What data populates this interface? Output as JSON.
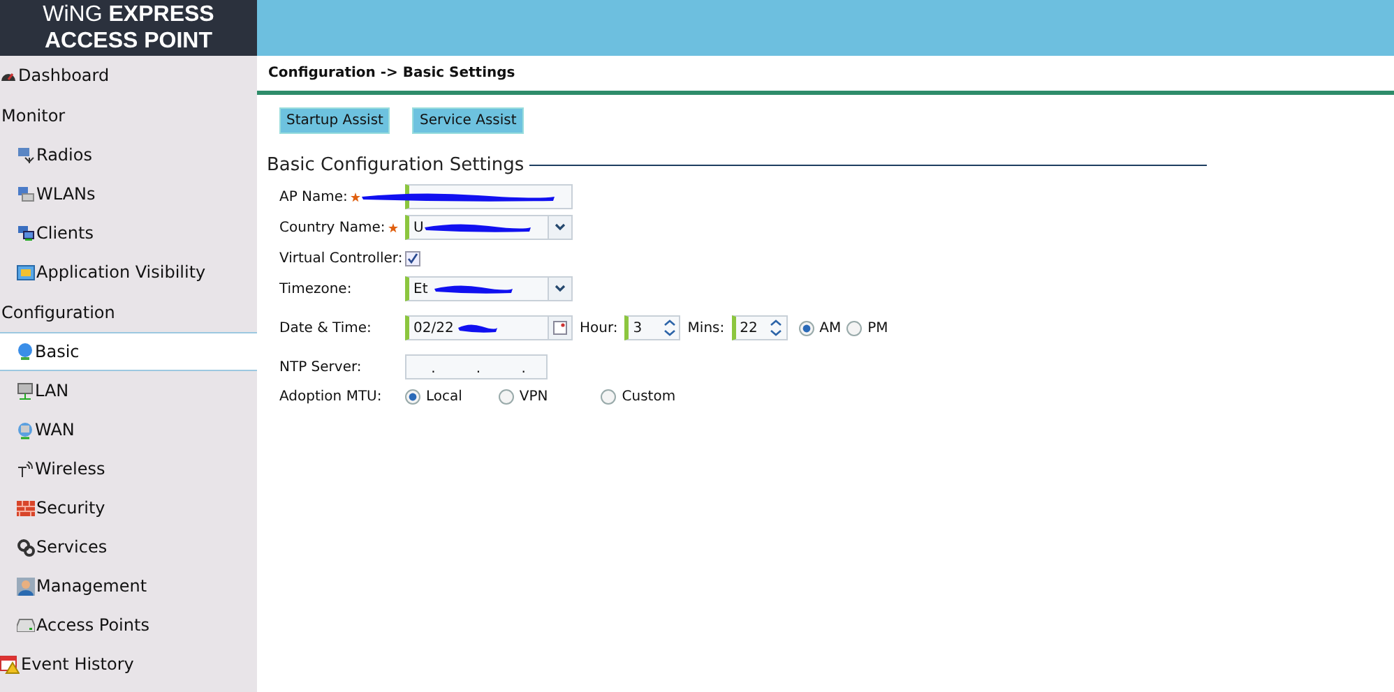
{
  "logo": {
    "line1_light": "WiNG",
    "line1_bold": "EXPRESS",
    "line2": "ACCESS POINT"
  },
  "sidebar": {
    "items": [
      {
        "kind": "link",
        "label": "Dashboard",
        "selected": false
      },
      {
        "kind": "heading",
        "label": "Monitor"
      },
      {
        "kind": "child",
        "label": "Radios",
        "selected": false
      },
      {
        "kind": "child",
        "label": "WLANs",
        "selected": false
      },
      {
        "kind": "child",
        "label": "Clients",
        "selected": false
      },
      {
        "kind": "child",
        "label": "Application Visibility",
        "selected": false
      },
      {
        "kind": "heading",
        "label": "Configuration"
      },
      {
        "kind": "child",
        "label": "Basic",
        "selected": true
      },
      {
        "kind": "child",
        "label": "LAN",
        "selected": false
      },
      {
        "kind": "child",
        "label": "WAN",
        "selected": false
      },
      {
        "kind": "child",
        "label": "Wireless",
        "selected": false
      },
      {
        "kind": "child",
        "label": "Security",
        "selected": false
      },
      {
        "kind": "child",
        "label": "Services",
        "selected": false
      },
      {
        "kind": "child",
        "label": "Management",
        "selected": false
      },
      {
        "kind": "child",
        "label": "Access Points",
        "selected": false
      },
      {
        "kind": "link",
        "label": "Event History",
        "selected": false
      }
    ]
  },
  "breadcrumb": "Configuration -> Basic Settings",
  "buttons": [
    "Startup Assist",
    "Service Assist"
  ],
  "section_title": "Basic Configuration Settings",
  "form": {
    "ap_name": {
      "label": "AP Name:",
      "required": true,
      "redacted": true
    },
    "country_name": {
      "label": "Country Name:",
      "required": true,
      "value": "U",
      "redacted": true
    },
    "virtual_controller": {
      "label": "Virtual Controller:",
      "checked": true
    },
    "timezone": {
      "label": "Timezone:",
      "value": "Et",
      "redacted": true
    },
    "date_time": {
      "label": "Date & Time:",
      "value": "02/22",
      "redacted": true,
      "hour_label": "Hour:",
      "hour": "3",
      "mins_label": "Mins:",
      "mins": "22",
      "ampm": [
        {
          "label": "AM",
          "selected": true
        },
        {
          "label": "PM",
          "selected": false
        }
      ]
    },
    "ntp_server": {
      "label": "NTP Server:",
      "separators": [
        ".",
        ".",
        "."
      ]
    },
    "adoption_mtu": {
      "label": "Adoption MTU:",
      "options": [
        {
          "label": "Local",
          "selected": true
        },
        {
          "label": "VPN",
          "selected": false
        },
        {
          "label": "Custom",
          "selected": false
        }
      ]
    }
  }
}
